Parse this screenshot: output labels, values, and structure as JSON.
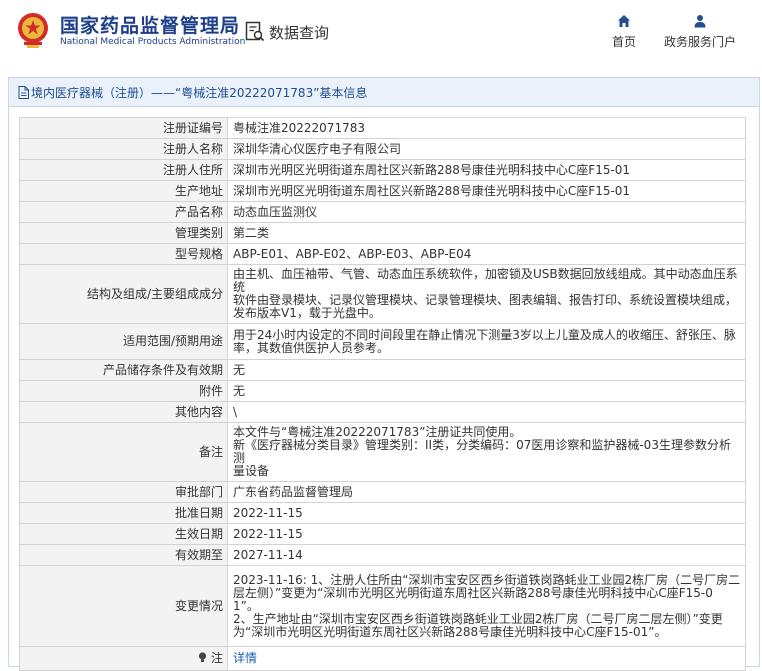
{
  "header": {
    "title_cn": "国家药品监督管理局",
    "title_en": "National Medical Products Administration",
    "query_label": "数据查询",
    "nav": [
      {
        "label": "首页",
        "icon": "home-icon"
      },
      {
        "label": "政务服务门户",
        "icon": "user-icon"
      }
    ]
  },
  "panel": {
    "title": "境内医疗器械（注册）——“粤械注准20222071783”基本信息"
  },
  "record": [
    {
      "label": "注册证编号",
      "value": "粤械注准20222071783"
    },
    {
      "label": "注册人名称",
      "value": "深圳华清心仪医疗电子有限公司"
    },
    {
      "label": "注册人住所",
      "value": "深圳市光明区光明街道东周社区兴新路288号康佳光明科技中心C座F15-01"
    },
    {
      "label": "生产地址",
      "value": "深圳市光明区光明街道东周社区兴新路288号康佳光明科技中心C座F15-01"
    },
    {
      "label": "产品名称",
      "value": "动态血压监测仪"
    },
    {
      "label": "管理类别",
      "value": "第二类"
    },
    {
      "label": "型号规格",
      "value": "ABP-E01、ABP-E02、ABP-E03、ABP-E04"
    },
    {
      "label": "结构及组成/主要组成成分",
      "lines": [
        "由主机、血压袖带、气管、动态血压系统软件，加密锁及USB数据回放线组成。其中动态血压系统",
        "软件由登录模块、记录仪管理模块、记录管理模块、图表编辑、报告打印、系统设置模块组成，",
        "发布版本V1，载于光盘中。"
      ]
    },
    {
      "label": "适用范围/预期用途",
      "lines": [
        "用于24小时内设定的不同时间段里在静止情况下测量3岁以上儿童及成人的收缩压、舒张压、脉",
        "率，其数值供医护人员参考。"
      ]
    },
    {
      "label": "产品储存条件及有效期",
      "value": "无"
    },
    {
      "label": "附件",
      "value": "无"
    },
    {
      "label": "其他内容",
      "value": "\\"
    },
    {
      "label": "备注",
      "lines": [
        "本文件与“粤械注准20222071783”注册证共同使用。",
        "新《医疗器械分类目录》管理类别：II类，分类编码：07医用诊察和监护器械-03生理参数分析测",
        "量设备"
      ]
    },
    {
      "label": "审批部门",
      "value": "广东省药品监督管理局"
    },
    {
      "label": "批准日期",
      "value": "2022-11-15"
    },
    {
      "label": "生效日期",
      "value": "2022-11-15"
    },
    {
      "label": "有效期至",
      "value": "2027-11-14"
    },
    {
      "label": "变更情况",
      "lines": [
        "2023-11-16: 1、注册人住所由“深圳市宝安区西乡街道铁岗路蚝业工业园2栋厂房（二号厂房二",
        "层左侧）”变更为“深圳市光明区光明街道东周社区兴新路288号康佳光明科技中心C座F15-0",
        "1”。",
        "2、生产地址由“深圳市宝安区西乡街道铁岗路蚝业工业园2栋厂房（二号厂房二层左侧）”变更",
        "为“深圳市光明区光明街道东周社区兴新路288号康佳光明科技中心C座F15-01”。"
      ]
    },
    {
      "label": "注",
      "value": "详情",
      "label_icon": "lightbulb-icon"
    }
  ]
}
